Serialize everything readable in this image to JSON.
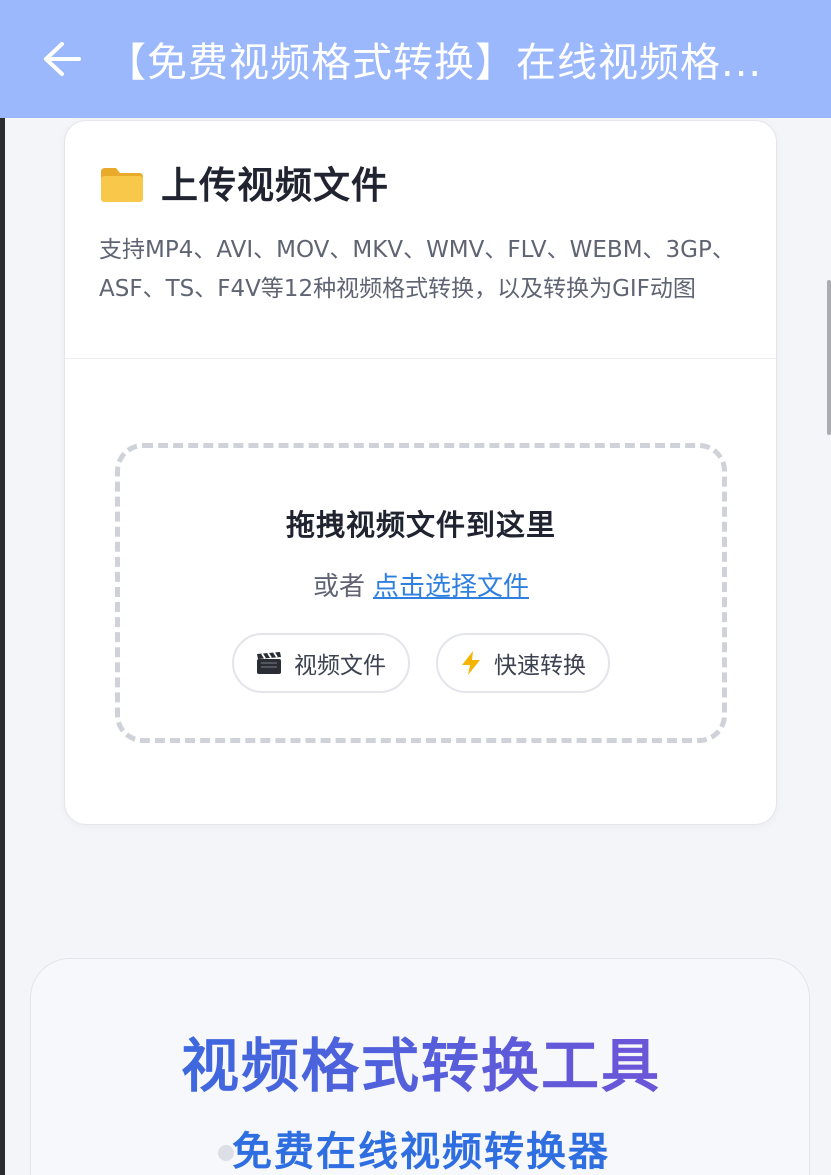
{
  "topbar": {
    "title": "【免费视频格式转换】在线视频格...",
    "background": "#9cb8fd"
  },
  "upload_card": {
    "title": "上传视频文件",
    "icon": "folder-icon",
    "description": "支持MP4、AVI、MOV、MKV、WMV、FLV、WEBM、3GP、ASF、TS、F4V等12种视频格式转换，以及转换为GIF动图",
    "dropzone": {
      "title": "拖拽视频文件到这里",
      "or_text": "或者",
      "select_link": "点击选择文件",
      "chips": [
        {
          "icon": "clapperboard-icon",
          "label": "视频文件"
        },
        {
          "icon": "lightning-icon",
          "label": "快速转换"
        }
      ]
    }
  },
  "tool_section": {
    "title": "视频格式转换工具",
    "subtitle": "免费在线视频转换器"
  },
  "colors": {
    "link": "#2f7fe0",
    "accent_gradient_start": "#2f6ee0",
    "accent_gradient_end": "#7b4fd6"
  }
}
